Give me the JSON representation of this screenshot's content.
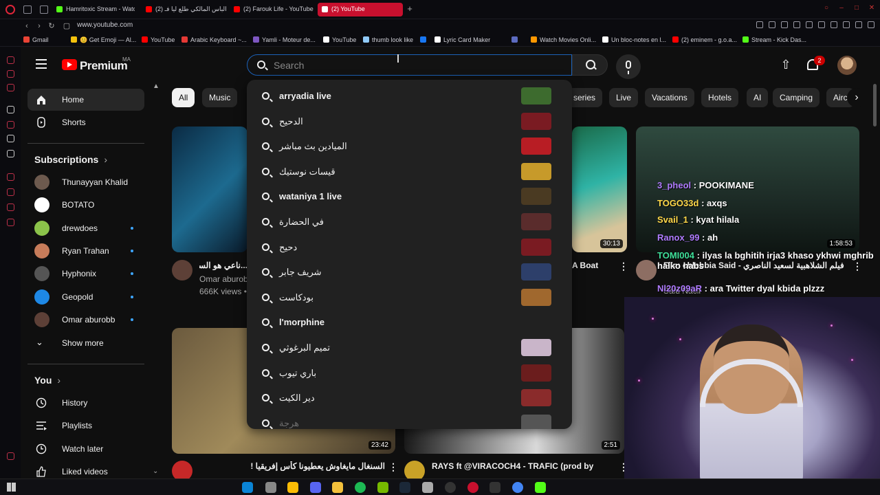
{
  "browser": {
    "tabs": [
      {
        "label": "Hamritoxic Stream - Watch",
        "color": "#53fc18"
      },
      {
        "label": "(2) الباس المالكي طلع ليا فـ",
        "color": "#ff0000"
      },
      {
        "label": "(2) Farouk Life - YouTube",
        "color": "#ff0000"
      },
      {
        "label": "(2) YouTube",
        "color": "#ff0000",
        "active": true
      }
    ],
    "url": "www.youtube.com",
    "bookmarks": [
      {
        "label": "Gmail",
        "color": "#ea4335"
      },
      {
        "label": "😊 Get Emoji — Al...",
        "color": "#f4c20d"
      },
      {
        "label": "YouTube",
        "color": "#ff0000"
      },
      {
        "label": "Arabic Keyboard ~...",
        "color": "#e53935"
      },
      {
        "label": "Yamli - Moteur de...",
        "color": "#7e57c2"
      },
      {
        "label": "YouTube",
        "color": "#ffffff"
      },
      {
        "label": "thumb look like",
        "color": "#90caf9"
      },
      {
        "label": "",
        "color": "#1877f2"
      },
      {
        "label": "Lyric Card Maker",
        "color": "#ffffff"
      },
      {
        "label": "",
        "color": "#5c6bc0"
      },
      {
        "label": "Watch Movies Onli...",
        "color": "#ff9800"
      },
      {
        "label": "Un bloc-notes en l...",
        "color": "#ffffff"
      },
      {
        "label": "(2) eminem - g.o.a...",
        "color": "#ff0000"
      },
      {
        "label": "Stream - Kick Das...",
        "color": "#53fc18"
      }
    ]
  },
  "header": {
    "brand": "Premium",
    "country": "MA",
    "search_placeholder": "Search",
    "notification_count": "2"
  },
  "sidebar": {
    "main": [
      {
        "label": "Home",
        "icon": "home-icon",
        "active": true
      },
      {
        "label": "Shorts",
        "icon": "shorts-icon"
      }
    ],
    "subscriptions_title": "Subscriptions",
    "subscriptions": [
      {
        "label": "Thunayyan Khalid",
        "color": "#6d5a4e",
        "dot": false
      },
      {
        "label": "BOTATO",
        "color": "#ffffff",
        "dot": false
      },
      {
        "label": "drewdoes",
        "color": "#8bc34a",
        "dot": true
      },
      {
        "label": "Ryan Trahan",
        "color": "#c77c5a",
        "dot": true
      },
      {
        "label": "Hyphonix",
        "color": "#555555",
        "dot": true
      },
      {
        "label": "Geopold",
        "color": "#1e88e5",
        "dot": true
      },
      {
        "label": "Omar aburobb",
        "color": "#5d4037",
        "dot": true
      }
    ],
    "show_more": "Show more",
    "you_title": "You",
    "you_items": [
      {
        "label": "History",
        "icon": "history-icon"
      },
      {
        "label": "Playlists",
        "icon": "playlists-icon"
      },
      {
        "label": "Watch later",
        "icon": "watch-later-icon"
      },
      {
        "label": "Liked videos",
        "icon": "liked-videos-icon"
      }
    ]
  },
  "chips": [
    "All",
    "Music",
    "series",
    "Live",
    "Vacations",
    "Hotels",
    "AI",
    "Camping",
    "Airc"
  ],
  "videos": [
    {
      "title": "...ناعي هو السبب",
      "channel": "Omar aburobb",
      "views": "666K views •"
    },
    {
      "title": "A Boat",
      "duration": "30:13"
    },
    {
      "title": "Film chlabbia Said - فيلم الشلاهبية لسعيد الناصري",
      "channel": "Said Nacir",
      "duration": "1:58:53"
    },
    {
      "title": "السنغال مايغاوش يعطيونا كأس إفريقيا !",
      "duration": "23:42"
    },
    {
      "title": "RAYS ft @VIRACOCH4 - TRAFIC (prod by",
      "duration": "2:51"
    }
  ],
  "suggestions": [
    {
      "text": "arryadia live",
      "bold": true,
      "thumb": "#3d6b2e"
    },
    {
      "text": "الدحيح",
      "bold": false,
      "thumb": "#7a1b22"
    },
    {
      "text": "الميادين بث مباشر",
      "bold": false,
      "thumb": "#b81d24"
    },
    {
      "text": "قيسات نوستيك",
      "bold": false,
      "thumb": "#c79a2a"
    },
    {
      "text": "wataniya 1 live",
      "bold": true,
      "thumb": "#4a3a22"
    },
    {
      "text": "في الحضارة",
      "bold": false,
      "thumb": "#5a2c2c"
    },
    {
      "text": "دحيح",
      "bold": false,
      "thumb": "#7a1b22"
    },
    {
      "text": "شريف جابر",
      "bold": false,
      "thumb": "#2d3f6a"
    },
    {
      "text": "بودكاست",
      "bold": false,
      "thumb": "#a0682e"
    },
    {
      "text": "l'morphine",
      "bold": true,
      "thumb": ""
    },
    {
      "text": "تميم البرغوثي",
      "bold": false,
      "thumb": "#c9b5c9"
    },
    {
      "text": "باري تيوب",
      "bold": false,
      "thumb": "#6b1d1d"
    },
    {
      "text": "دير الكيت",
      "bold": false,
      "thumb": "#8a2b2b"
    },
    {
      "text": "هرجة",
      "bold": false,
      "thumb": "#555555"
    }
  ],
  "chat": [
    {
      "user": "3_pheol",
      "msg": "POOKIMANE",
      "color": "#b07cff"
    },
    {
      "user": "TOGO33d",
      "msg": "axqs",
      "color": "#ffd84a"
    },
    {
      "user": "Svail_1",
      "msg": "kyat hilala",
      "color": "#ffd84a"
    },
    {
      "user": "Ranox_99",
      "msg": "ah",
      "color": "#b07cff"
    },
    {
      "user": "TOMI004",
      "msg": "ilyas la bghitih irja3 khaso ykhwi mghrib halko habs",
      "color": "#3fe09a"
    },
    {
      "user": "Nl20z09aR",
      "msg": "ara Twitter dyal kbida plzzz",
      "color": "#b07cff"
    }
  ]
}
